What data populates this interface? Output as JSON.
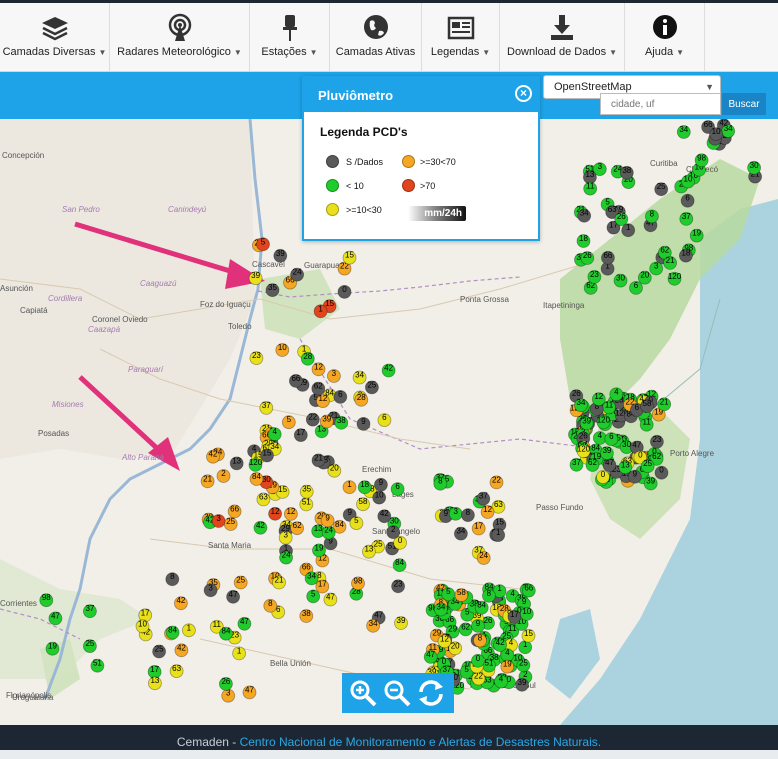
{
  "nav": {
    "items": [
      {
        "label": "Camadas Diversas",
        "icon": "layers-icon"
      },
      {
        "label": "Radares Meteorológico",
        "icon": "radar-icon"
      },
      {
        "label": "Estações",
        "icon": "station-icon"
      },
      {
        "label": "Camadas Ativas",
        "icon": "globe-icon"
      },
      {
        "label": "Legendas",
        "icon": "newspaper-icon"
      },
      {
        "label": "Download de Dados",
        "icon": "download-icon"
      },
      {
        "label": "Ajuda",
        "icon": "info-icon"
      }
    ]
  },
  "legend": {
    "title": "Pluviômetro",
    "subtitle": "Legenda PCD's",
    "items": [
      {
        "label": "S /Dados",
        "color": "#5a5a5a"
      },
      {
        "label": ">=30<70",
        "color": "#f5a623"
      },
      {
        "label": "< 10",
        "color": "#1fcc2c"
      },
      {
        "label": ">70",
        "color": "#e0451e"
      },
      {
        "label": ">=10<30",
        "color": "#e8e01a"
      }
    ],
    "unit": "mm/24h"
  },
  "layer_select": {
    "value": "OpenStreetMap"
  },
  "search": {
    "placeholder": "cidade, uf",
    "button": "Buscar"
  },
  "map": {
    "places": [
      "Concepción",
      "San Pedro",
      "Canindeyú",
      "Caaguazú",
      "Asunción",
      "Cordillera",
      "Capiatá",
      "Coronel Oviedo",
      "Caazapá",
      "Paraguarí",
      "Misiones",
      "Posadas",
      "Alto Paraná",
      "Foz do Iguaçu",
      "Toledo",
      "Cascavel",
      "Guarapuava",
      "Ponta Grossa",
      "Itapetininga",
      "Chapecó",
      "Erechim",
      "Lages",
      "Passo Fundo",
      "Santo Ângelo",
      "Santa Maria",
      "Bella Unión",
      "Uruguaiana",
      "Florianópolis",
      "Porto Alegre",
      "Rio Grande do Sul",
      "Curitiba",
      "Corrientes"
    ],
    "stations_label_sample": [
      "0",
      "1",
      "2",
      "3",
      "4",
      "5",
      "6",
      "8",
      "9",
      "10",
      "11",
      "12",
      "13",
      "15",
      "17",
      "18",
      "19",
      "20",
      "21",
      "22",
      "23",
      "24",
      "25",
      "26",
      "28",
      "29",
      "30",
      "34",
      "35",
      "37",
      "38",
      "39",
      "42",
      "47",
      "51",
      "58",
      "62",
      "63",
      "66",
      "84",
      "98",
      "120"
    ]
  },
  "footer": {
    "prefix": "Cemaden - ",
    "link": "Centro Nacional de Monitoramento e Alertas de Desastres Naturais."
  }
}
